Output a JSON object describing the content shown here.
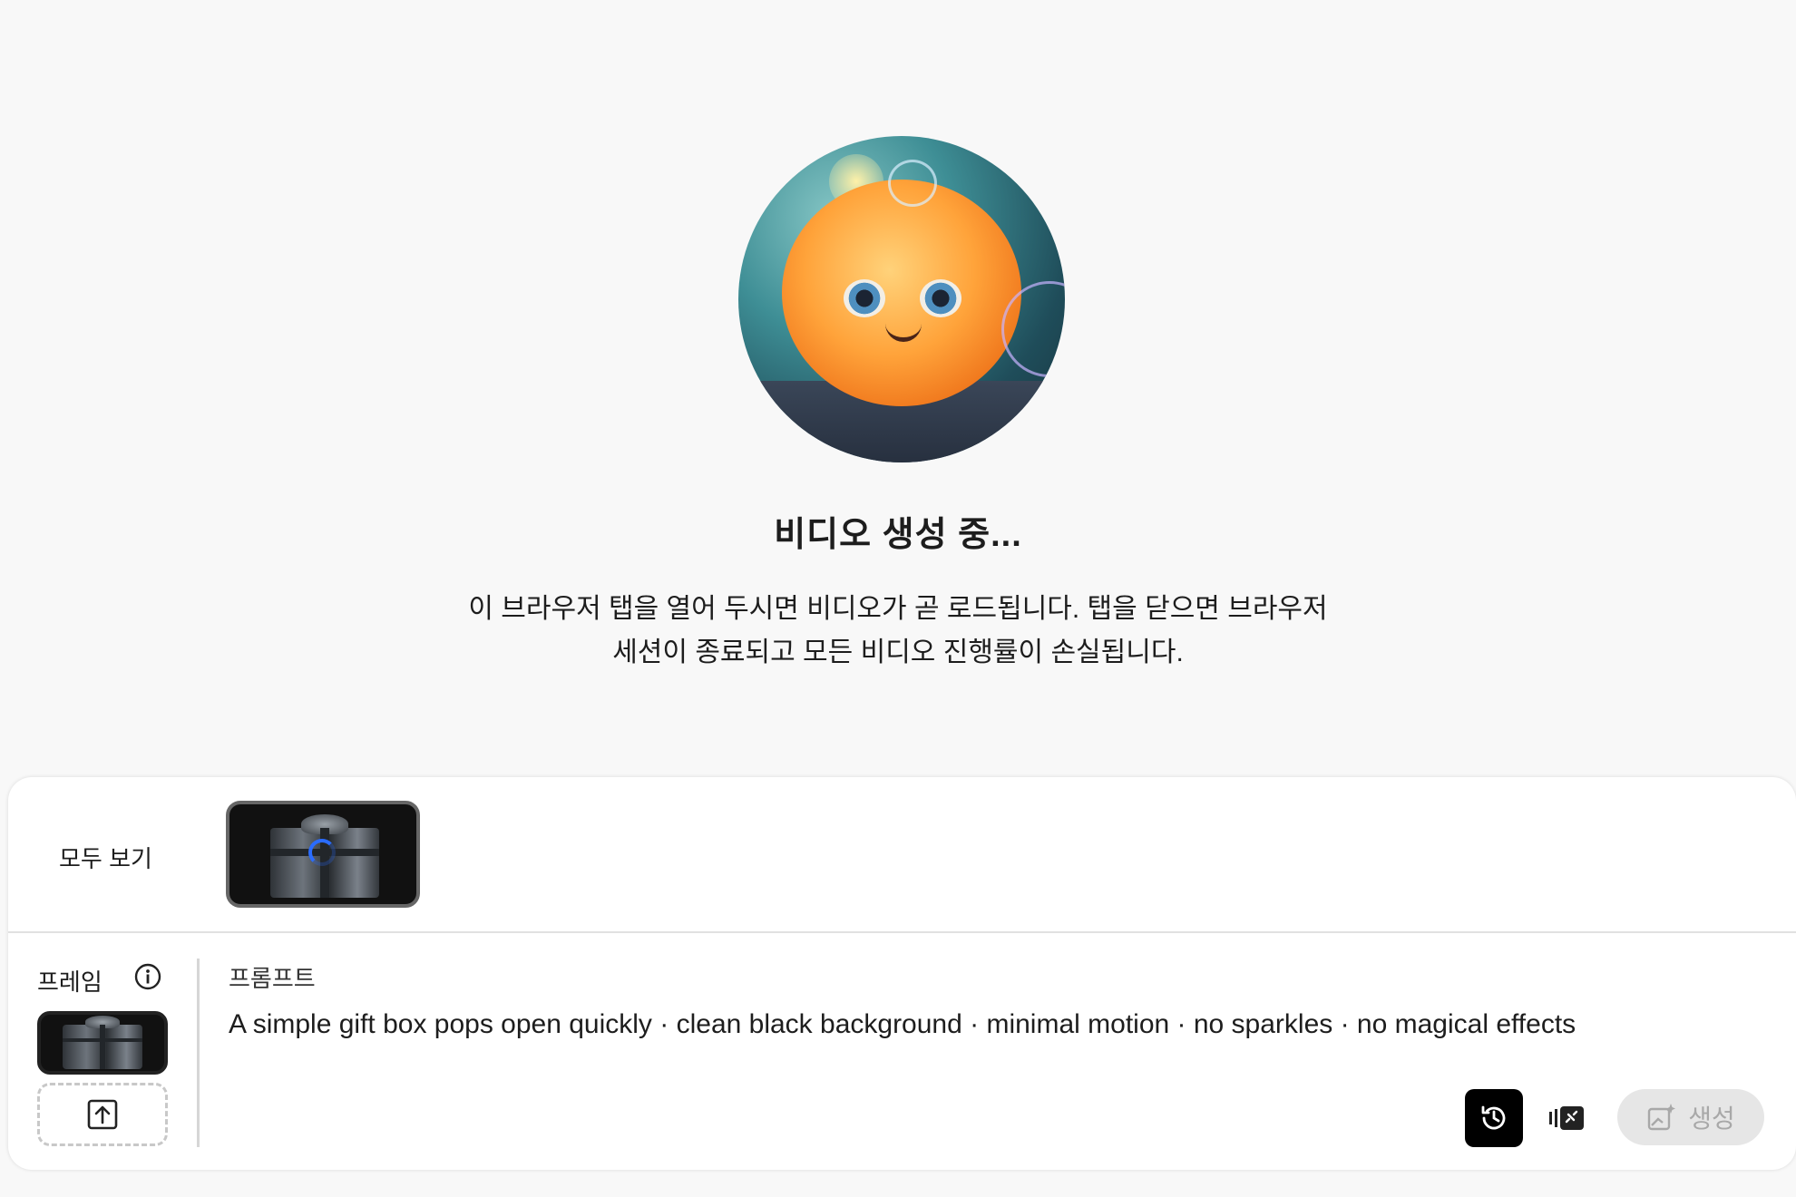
{
  "status": {
    "title": "비디오 생성 중...",
    "description_line1": "이 브라우저 탭을 열어 두시면 비디오가 곧 로드됩니다. 탭을 닫으면 브라우저",
    "description_line2": "세션이 종료되고 모든 비디오 진행률이 손실됩니다."
  },
  "gallery": {
    "view_all_label": "모두 보기"
  },
  "frame": {
    "label": "프레임"
  },
  "prompt": {
    "label": "프롬프트",
    "text": "A simple gift box pops open quickly · clean black background · minimal motion · no sparkles · no magical effects"
  },
  "actions": {
    "generate_label": "생성"
  },
  "icons": {
    "info": "info-icon",
    "upload": "upload-icon",
    "history": "history-icon",
    "style": "style-icon",
    "generate": "sparkle-image-icon"
  },
  "colors": {
    "background": "#f8f8f8",
    "panel": "#ffffff",
    "spinner": "#2a6cff",
    "history_button": "#000000",
    "generate_disabled": "#e6e6e6"
  }
}
